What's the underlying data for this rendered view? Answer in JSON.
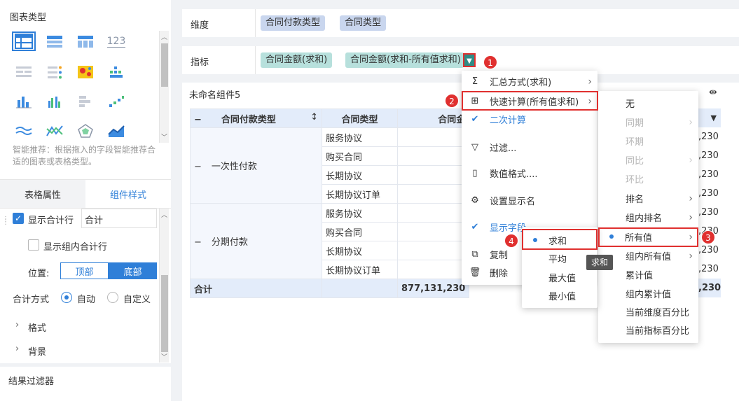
{
  "left": {
    "chart_type_title": "图表类型",
    "chart_type_tile_label": "123",
    "smart_hint": "智能推荐：根据拖入的字段智能推荐合适的图表或表格类型。",
    "tabs": [
      "表格属性",
      "组件样式"
    ],
    "show_total_row": "显示合计行",
    "total_label_value": "合计",
    "show_group_total_row": "显示组内合计行",
    "position_label": "位置:",
    "position_options": [
      "顶部",
      "底部"
    ],
    "total_mode_label": "合计方式",
    "total_mode_options": [
      "自动",
      "自定义"
    ],
    "format_label": "格式",
    "background_label": "背景",
    "result_filter": "结果过滤器"
  },
  "dimension": {
    "label": "维度",
    "fields": [
      "合同付款类型",
      "合同类型"
    ]
  },
  "indicator": {
    "label": "指标",
    "fields": [
      "合同金额(求和)",
      "合同金额(求和-所有值求和)"
    ]
  },
  "component": {
    "title": "未命名组件5"
  },
  "table": {
    "headers": [
      "合同付款类型",
      "合同类型",
      "合同金"
    ],
    "groups": [
      {
        "name": "一次性付款",
        "types": [
          "服务协议",
          "购买合同",
          "长期协议",
          "长期协议订单"
        ]
      },
      {
        "name": "分期付款",
        "types": [
          "服务协议",
          "购买合同",
          "长期协议",
          "长期协议订单"
        ]
      }
    ],
    "right_values": [
      ",230",
      ",230",
      ",230",
      ",230",
      ",230",
      ",230",
      ",230",
      ",230"
    ],
    "total_label": "合计",
    "total_value": "877,131,230",
    "total_right": ",230"
  },
  "menu1": {
    "items": [
      "汇总方式(求和)",
      "快速计算(所有值求和)",
      "二次计算",
      "过滤...",
      "数值格式....",
      "设置显示名",
      "显示字段",
      "复制",
      "删除"
    ]
  },
  "menu2": {
    "items": [
      "无",
      "同期",
      "环期",
      "同比",
      "环比",
      "排名",
      "组内排名",
      "所有值",
      "组内所有值",
      "累计值",
      "组内累计值",
      "当前维度百分比",
      "当前指标百分比"
    ]
  },
  "menu3": {
    "items": [
      "求和",
      "平均",
      "最大值",
      "最小值"
    ]
  },
  "tooltip": "求和",
  "badges": [
    "1",
    "2",
    "3",
    "4"
  ],
  "colors": {
    "accent": "#2f7fd8",
    "highlight": "#e0302f"
  }
}
